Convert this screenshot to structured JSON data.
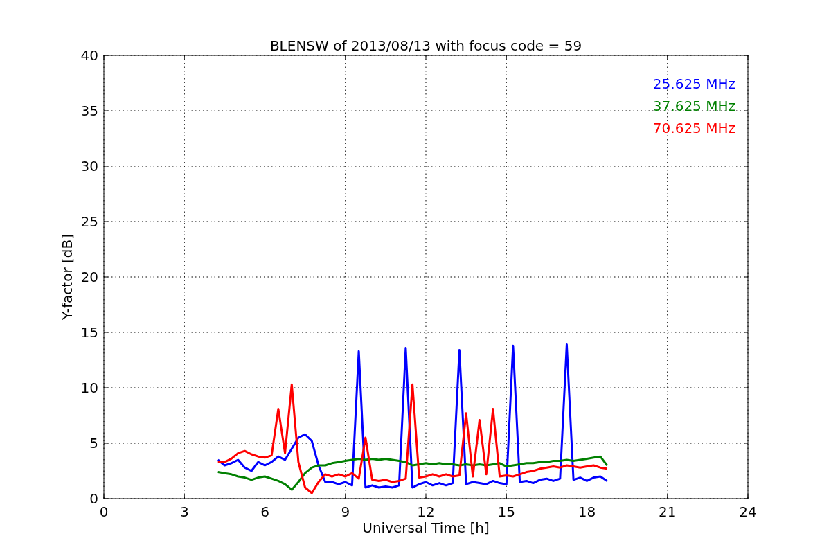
{
  "chart_data": {
    "type": "line",
    "title": "BLENSW of 2013/08/13 with focus code = 59",
    "xlabel": "Universal Time [h]",
    "ylabel": "Y-factor [dB]",
    "x": [
      4.25,
      4.5,
      4.75,
      5.0,
      5.25,
      5.5,
      5.75,
      6.0,
      6.25,
      6.5,
      6.75,
      7.0,
      7.25,
      7.5,
      7.75,
      8.0,
      8.25,
      8.5,
      8.75,
      9.0,
      9.25,
      9.5,
      9.75,
      10.0,
      10.25,
      10.5,
      10.75,
      11.0,
      11.25,
      11.5,
      11.75,
      12.0,
      12.25,
      12.5,
      12.75,
      13.0,
      13.25,
      13.5,
      13.75,
      14.0,
      14.25,
      14.5,
      14.75,
      15.0,
      15.25,
      15.5,
      15.75,
      16.0,
      16.25,
      16.5,
      16.75,
      17.0,
      17.25,
      17.5,
      17.75,
      18.0,
      18.25,
      18.5,
      18.75
    ],
    "series": [
      {
        "name": "25.625 MHz",
        "color": "#0000ff",
        "values": [
          3.5,
          3.0,
          3.2,
          3.5,
          2.8,
          2.5,
          3.3,
          3.0,
          3.3,
          3.8,
          3.5,
          4.5,
          5.5,
          5.8,
          5.2,
          3.0,
          1.5,
          1.5,
          1.3,
          1.5,
          1.2,
          13.3,
          1.0,
          1.2,
          1.0,
          1.1,
          1.0,
          1.2,
          13.6,
          1.0,
          1.3,
          1.5,
          1.2,
          1.4,
          1.2,
          1.4,
          13.4,
          1.3,
          1.5,
          1.4,
          1.3,
          1.6,
          1.4,
          1.3,
          13.8,
          1.5,
          1.6,
          1.4,
          1.7,
          1.8,
          1.6,
          1.8,
          13.9,
          1.7,
          1.9,
          1.6,
          1.9,
          2.0,
          1.6
        ]
      },
      {
        "name": "37.625 MHz",
        "color": "#008000",
        "values": [
          2.4,
          2.3,
          2.2,
          2.0,
          1.9,
          1.7,
          1.9,
          2.0,
          1.8,
          1.6,
          1.3,
          0.8,
          1.5,
          2.3,
          2.8,
          3.0,
          3.0,
          3.2,
          3.3,
          3.4,
          3.5,
          3.6,
          3.5,
          3.6,
          3.5,
          3.6,
          3.5,
          3.4,
          3.3,
          3.0,
          3.1,
          3.2,
          3.1,
          3.2,
          3.1,
          3.1,
          3.0,
          3.1,
          3.0,
          3.1,
          3.0,
          3.1,
          3.2,
          2.9,
          3.0,
          3.1,
          3.2,
          3.2,
          3.3,
          3.3,
          3.4,
          3.4,
          3.5,
          3.4,
          3.5,
          3.6,
          3.7,
          3.8,
          3.0
        ]
      },
      {
        "name": "70.625 MHz",
        "color": "#ff0000",
        "values": [
          3.3,
          3.3,
          3.6,
          4.1,
          4.3,
          4.0,
          3.8,
          3.7,
          3.9,
          8.1,
          4.1,
          10.3,
          3.3,
          1.0,
          0.5,
          1.5,
          2.2,
          2.0,
          2.2,
          2.0,
          2.3,
          1.8,
          5.5,
          1.7,
          1.6,
          1.7,
          1.5,
          1.6,
          1.8,
          10.3,
          1.9,
          2.0,
          2.2,
          2.0,
          2.2,
          2.0,
          2.1,
          7.7,
          2.0,
          7.1,
          2.2,
          8.1,
          2.0,
          2.1,
          2.0,
          2.2,
          2.4,
          2.5,
          2.7,
          2.8,
          2.9,
          2.8,
          3.0,
          2.9,
          2.8,
          2.9,
          3.0,
          2.8,
          2.7
        ]
      }
    ],
    "grid": true,
    "xlim": [
      0,
      24
    ],
    "ylim": [
      0,
      40
    ],
    "xticks": [
      0,
      3,
      6,
      9,
      12,
      15,
      18,
      21,
      24
    ],
    "yticks": [
      0,
      5,
      10,
      15,
      20,
      25,
      30,
      35,
      40
    ]
  }
}
